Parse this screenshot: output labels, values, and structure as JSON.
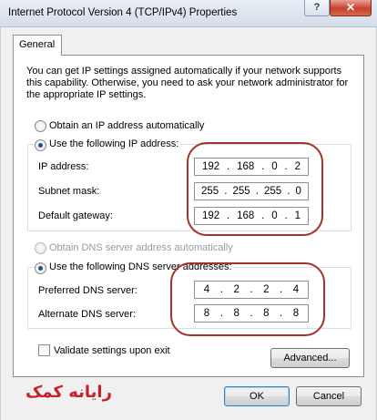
{
  "window": {
    "title": "Internet Protocol Version 4 (TCP/IPv4) Properties",
    "help_glyph": "?",
    "close_glyph": "✕"
  },
  "tabs": [
    {
      "label": "General"
    }
  ],
  "description": "You can get IP settings assigned automatically if your network supports this capability. Otherwise, you need to ask your network administrator for the appropriate IP settings.",
  "ip_section": {
    "auto_label": "Obtain an IP address automatically",
    "manual_label": "Use the following IP address:",
    "selected": "manual",
    "fields": [
      {
        "label": "IP address:",
        "octets": [
          "192",
          "168",
          "0",
          "2"
        ]
      },
      {
        "label": "Subnet mask:",
        "octets": [
          "255",
          "255",
          "255",
          "0"
        ]
      },
      {
        "label": "Default gateway:",
        "octets": [
          "192",
          "168",
          "0",
          "1"
        ]
      }
    ]
  },
  "dns_section": {
    "auto_label": "Obtain DNS server address automatically",
    "manual_label": "Use the following DNS server addresses:",
    "selected": "manual",
    "fields": [
      {
        "label": "Preferred DNS server:",
        "octets": [
          "4",
          "2",
          "2",
          "4"
        ]
      },
      {
        "label": "Alternate DNS server:",
        "octets": [
          "8",
          "8",
          "8",
          "8"
        ]
      }
    ]
  },
  "validate_label": "Validate settings upon exit",
  "validate_checked": false,
  "buttons": {
    "advanced": "Advanced...",
    "ok": "OK",
    "cancel": "Cancel"
  },
  "watermark": {
    "text": "رایانه کمک"
  },
  "colors": {
    "annotation_oval": "#a2322b",
    "watermark": "#c8202b",
    "radio_dot": "#1d4f91"
  }
}
